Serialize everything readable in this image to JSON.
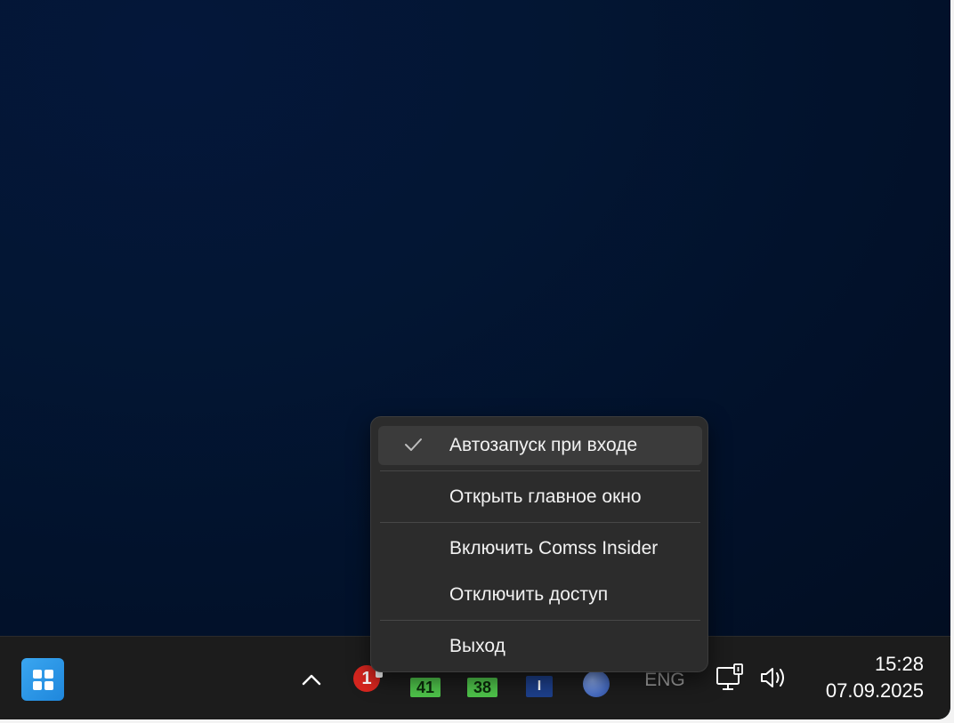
{
  "context_menu": {
    "items": [
      {
        "label": "Автозапуск при входе",
        "checked": true
      },
      {
        "label": "Открыть главное окно",
        "checked": false
      },
      {
        "label": "Включить Comss Insider",
        "checked": false
      },
      {
        "label": "Отключить доступ",
        "checked": false
      },
      {
        "label": "Выход",
        "checked": false
      }
    ]
  },
  "taskbar": {
    "tray": {
      "app_badge_text": "1",
      "counter_a": "41",
      "counter_b": "38",
      "blue_app_text": "I",
      "language": "ENG"
    },
    "clock": {
      "time": "15:28",
      "date": "07.09.2025"
    }
  },
  "colors": {
    "desktop_bg": "#031633",
    "taskbar_bg": "#1c1c1c",
    "menu_bg": "#2c2c2c",
    "start_accent": "#2a95e6"
  },
  "icons": {
    "start": "windows-logo-icon",
    "chevron": "chevron-up-icon",
    "network": "network-monitor-icon",
    "volume": "speaker-icon",
    "check": "checkmark-icon"
  }
}
